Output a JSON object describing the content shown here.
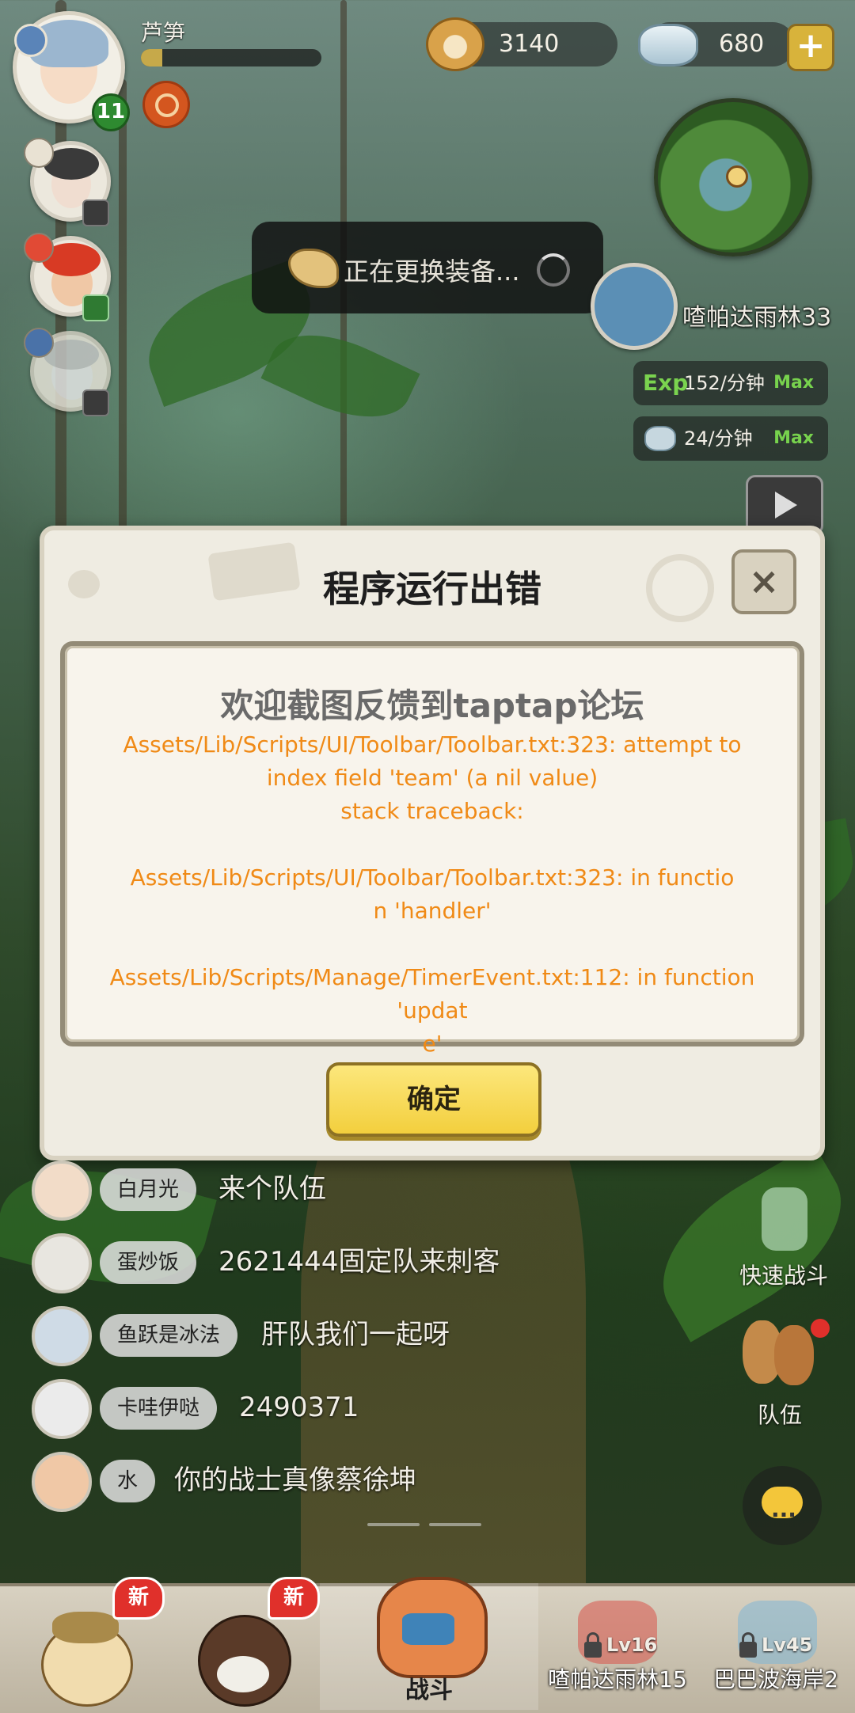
{
  "player": {
    "name": "芦笋",
    "level": "11",
    "exp_progress": 0.12
  },
  "currencies": {
    "shells": "3140",
    "gems": "680",
    "plus_label": "+"
  },
  "loading": {
    "text": "正在更换装备..."
  },
  "map": {
    "name": "喳帕达雨林33"
  },
  "stats": {
    "exp_label": "Exp",
    "exp_rate": "152/分钟",
    "exp_max": "Max",
    "gem_rate": "24/分钟",
    "gem_max": "Max"
  },
  "dialog": {
    "title": "程序运行出错",
    "close_label": "×",
    "headline": "欢迎截图反馈到taptap论坛",
    "body": "Assets/Lib/Scripts/UI/Toolbar/Toolbar.txt:323: attempt to\nindex field 'team' (a nil value)\nstack traceback:\n\nAssets/Lib/Scripts/UI/Toolbar/Toolbar.txt:323: in functio\nn 'handler'\n\nAssets/Lib/Scripts/Manage/TimerEvent.txt:112: in function 'updat\ne'",
    "ok_label": "确定"
  },
  "chat": [
    {
      "name": "白月光",
      "message": "来个队伍"
    },
    {
      "name": "蛋炒饭",
      "message": "2621444固定队来刺客"
    },
    {
      "name": "鱼跃是冰法",
      "message": "肝队我们一起呀"
    },
    {
      "name": "卡哇伊哒",
      "message": "2490371"
    },
    {
      "name": "水",
      "message": "你的战士真像蔡徐坤"
    }
  ],
  "side_buttons": {
    "quick_battle": "快速战斗",
    "team": "队伍",
    "chat_icon": "..."
  },
  "bottom_nav": {
    "new_badge": "新",
    "battle_label": "战斗",
    "locked": [
      {
        "level": "Lv16",
        "name": "喳帕达雨林15"
      },
      {
        "level": "Lv45",
        "name": "巴巴波海岸2"
      }
    ]
  },
  "colors": {
    "error_text": "#f08a16",
    "ok_button": "#f3cf3d",
    "level_badge": "#2e8a30",
    "new_badge": "#e0302b"
  },
  "icons": {
    "shell": "pearl-shell-icon",
    "gem": "gem-icon",
    "horn": "horn-icon",
    "spinner": "loading-spinner-icon",
    "close": "close-icon",
    "lock": "lock-icon",
    "chat": "chat-bubble-icon"
  }
}
